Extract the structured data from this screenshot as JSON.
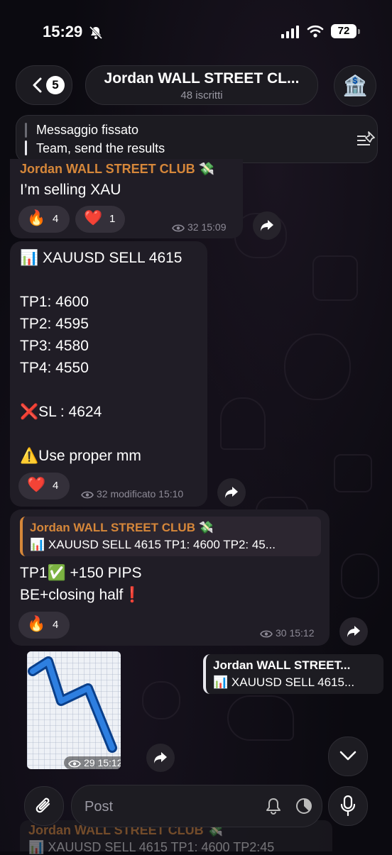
{
  "status": {
    "time": "15:29",
    "battery": "72"
  },
  "header": {
    "back_count": "5",
    "title": "Jordan WALL STREET CL...",
    "subtitle": "48 iscritti",
    "avatar_emoji": "🏦"
  },
  "pinned": {
    "label": "Messaggio fissato",
    "text": "Team, send the results"
  },
  "messages": {
    "m1": {
      "sender": "Jordan WALL STREET CLUB 💸",
      "text": "I’m selling XAU",
      "reactions": [
        {
          "emoji": "🔥",
          "count": "4"
        },
        {
          "emoji": "❤️",
          "count": "1"
        }
      ],
      "views": "32",
      "time": "15:09"
    },
    "m2": {
      "text": "📊 XAUUSD SELL 4615\n\nTP1: 4600\nTP2: 4595\nTP3: 4580\nTP4: 4550\n\n❌SL : 4624\n\n⚠️Use proper mm",
      "reactions": [
        {
          "emoji": "❤️",
          "count": "4"
        }
      ],
      "views": "32",
      "edited": "modificato",
      "time": "15:10"
    },
    "m3": {
      "quote_sender": "Jordan WALL STREET CLUB 💸",
      "quote_text": "📊 XAUUSD SELL 4615 TP1: 4600 TP2: 45...",
      "text": "TP1✅ +150 PIPS\nBE+closing half❗",
      "reactions": [
        {
          "emoji": "🔥",
          "count": "4"
        }
      ],
      "views": "30",
      "time": "15:12"
    },
    "m4": {
      "quote_sender": "Jordan WALL STREET...",
      "quote_text": "📊 XAUUSD SELL 4615...",
      "sticker": "chart-decreasing-sticker",
      "views": "29",
      "time": "15:12"
    }
  },
  "composer": {
    "placeholder": "Post"
  },
  "ghost": {
    "sender": "Jordan WALL STREET CLUB 💸",
    "text": "📊 XAUUSD SELL 4615 TP1: 4600 TP2:45"
  },
  "icons": [
    "bell-slash-icon",
    "signal-icon",
    "wifi-icon",
    "battery-icon",
    "chevron-left-icon",
    "pin-list-icon",
    "eye-icon",
    "forward-icon",
    "chevron-down-icon",
    "paperclip-icon",
    "bell-icon",
    "timer-icon",
    "microphone-icon"
  ],
  "colors": {
    "accent": "#d6873a",
    "bubble": "#201d26",
    "background": "#0b0a10"
  }
}
